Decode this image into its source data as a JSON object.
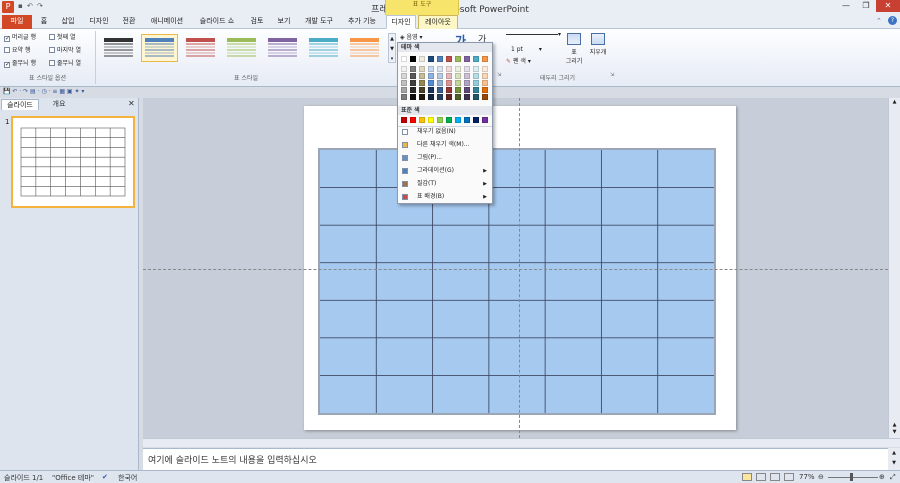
{
  "window": {
    "title": "프레젠테이션2 - Microsoft PowerPoint",
    "context_group": "표 도구",
    "app_icon": "P",
    "buttons": [
      "—",
      "❐",
      "✕"
    ]
  },
  "tabs": {
    "file": "파일",
    "items": [
      "홈",
      "삽입",
      "디자인",
      "전환",
      "애니메이션",
      "슬라이드 쇼",
      "검토",
      "보기",
      "개발 도구",
      "추가 기능"
    ],
    "ctx_design": "디자인",
    "ctx_layout": "레이아웃"
  },
  "ribbon": {
    "style_options": {
      "label": "표 스타일 옵션",
      "checks": [
        {
          "label": "머리글 행",
          "checked": true
        },
        {
          "label": "첫째 열",
          "checked": false
        },
        {
          "label": "요약 행",
          "checked": false
        },
        {
          "label": "마지막 열",
          "checked": false
        },
        {
          "label": "줄무늬 행",
          "checked": true
        },
        {
          "label": "줄무늬 열",
          "checked": false
        }
      ]
    },
    "table_styles": {
      "label": "표 스타일",
      "colors": [
        "#333333",
        "#4f81bd",
        "#c0504d",
        "#9bbb59",
        "#8064a2",
        "#4bacc6",
        "#f79646"
      ]
    },
    "shading_label": "음영",
    "pen_weight": "1 pt",
    "pen_color": "펜 색",
    "draw_table": "표",
    "draw_table2": "그리기",
    "eraser": "지우개",
    "borders_label": "테두리 그리기",
    "shading_letter": "가"
  },
  "dropdown": {
    "theme_header": "테마 색",
    "standard_header": "표준 색",
    "theme_top": [
      "#ffffff",
      "#000000",
      "#eeece1",
      "#1f497d",
      "#4f81bd",
      "#c0504d",
      "#9bbb59",
      "#8064a2",
      "#4bacc6",
      "#f79646"
    ],
    "theme_shades": [
      [
        "#f2f2f2",
        "#7f7f7f",
        "#ddd9c3",
        "#c6d9f0",
        "#dbe5f1",
        "#f2dcdb",
        "#ebf1dd",
        "#e5e0ec",
        "#dbeef3",
        "#fdeada"
      ],
      [
        "#d8d8d8",
        "#595959",
        "#c4bd97",
        "#8db3e2",
        "#b8cce4",
        "#e5b9b7",
        "#d7e3bc",
        "#ccc1d9",
        "#b7dde8",
        "#fbd5b5"
      ],
      [
        "#bfbfbf",
        "#3f3f3f",
        "#938953",
        "#548dd4",
        "#95b3d7",
        "#d99694",
        "#c3d69b",
        "#b2a2c7",
        "#92cddc",
        "#fac08f"
      ],
      [
        "#a5a5a5",
        "#262626",
        "#494429",
        "#17365d",
        "#366092",
        "#953734",
        "#76923c",
        "#5f497a",
        "#31859b",
        "#e36c09"
      ],
      [
        "#7f7f7f",
        "#0c0c0c",
        "#1d1b10",
        "#0f243e",
        "#244061",
        "#632423",
        "#4f6128",
        "#3f3151",
        "#205867",
        "#974806"
      ]
    ],
    "standard": [
      "#c00000",
      "#ff0000",
      "#ffc000",
      "#ffff00",
      "#92d050",
      "#00b050",
      "#00b0f0",
      "#0070c0",
      "#002060",
      "#7030a0"
    ],
    "items": [
      {
        "label": "채우기 없음(N)",
        "icon": "no-fill-icon",
        "submenu": false
      },
      {
        "label": "다른 채우기 색(M)...",
        "icon": "color-wheel-icon",
        "submenu": false
      },
      {
        "label": "그림(P)...",
        "icon": "picture-icon",
        "submenu": false
      },
      {
        "label": "그라데이션(G)",
        "icon": "gradient-icon",
        "submenu": true
      },
      {
        "label": "질감(T)",
        "icon": "texture-icon",
        "submenu": true
      },
      {
        "label": "표 배경(B)",
        "icon": "table-background-icon",
        "submenu": true
      }
    ]
  },
  "panel": {
    "tab_slides": "슬라이드",
    "tab_outline": "개요",
    "close": "✕",
    "slide_number": "1"
  },
  "table": {
    "rows": 7,
    "cols": 7,
    "fill": "#a6c9f0",
    "line": "#404a66"
  },
  "notes_placeholder": "여기에 슬라이드 노트의 내용을 입력하십시오",
  "status": {
    "slide": "슬라이드 1/1",
    "theme": "\"Office 테마\"",
    "language": "한국어",
    "zoom": "77%"
  }
}
